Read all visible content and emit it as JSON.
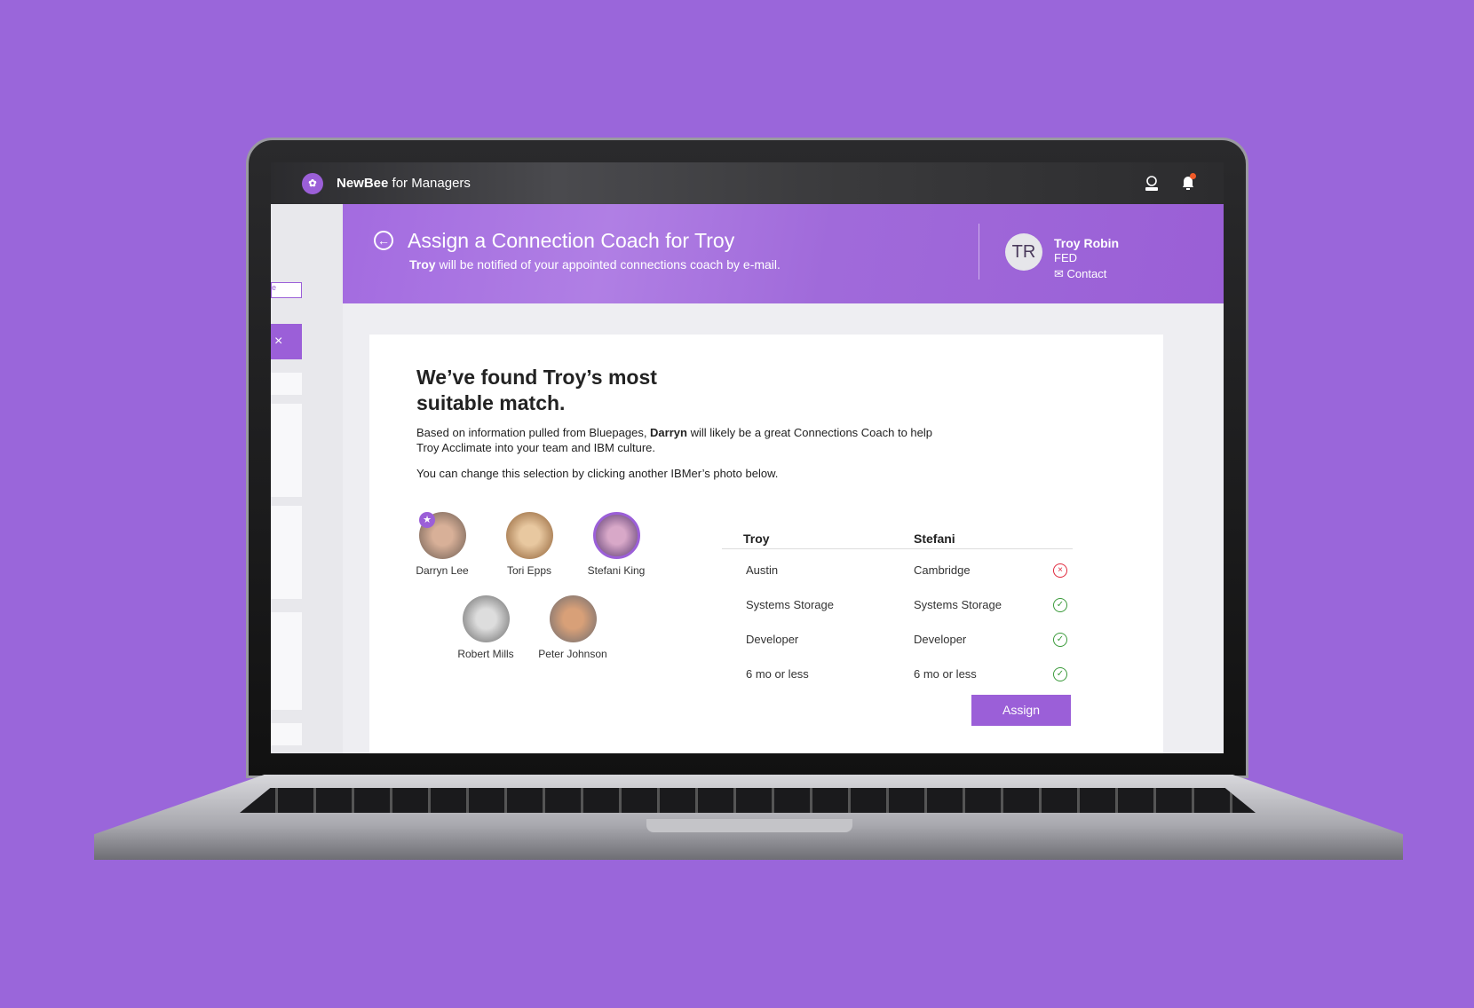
{
  "app": {
    "brand": "NewBee",
    "suffix": " for Managers",
    "logo_icon": "bee-icon",
    "notification_count": "1"
  },
  "sidebar": {
    "input_fragment": "e"
  },
  "header": {
    "title": "Assign a Connection Coach for Troy",
    "subtitle_bold": "Troy",
    "subtitle_rest": " will be notified of your appointed connections coach by e-mail.",
    "employee": {
      "initials": "TR",
      "name": "Troy Robin",
      "role": "FED",
      "contact": "Contact"
    }
  },
  "card": {
    "heading": "We’ve found Troy’s most suitable match.",
    "para1_a": "Based on information pulled from Bluepages, ",
    "para1_b": "Darryn",
    "para1_c": " will likely be a great Connections Coach to help Troy Acclimate into your team and IBM culture.",
    "para2": "You can change this selection by clicking another IBMer’s photo below.",
    "people": [
      {
        "name": "Darryn Lee",
        "recommended": true,
        "color": "#8a7060"
      },
      {
        "name": "Tori Epps",
        "color": "#b08050"
      },
      {
        "name": "Stefani King",
        "selected": true,
        "color": "#7a5a90"
      },
      {
        "name": "Robert Mills",
        "color": "#999999"
      },
      {
        "name": "Peter Johnson",
        "color": "#a0683a"
      }
    ],
    "compare": {
      "headers": [
        "Troy",
        "Stefani"
      ],
      "rows": [
        {
          "troy": "Austin",
          "stefani": "Cambridge",
          "match": false
        },
        {
          "troy": "Systems Storage",
          "stefani": "Systems Storage",
          "match": true
        },
        {
          "troy": "Developer",
          "stefani": "Developer",
          "match": true
        },
        {
          "troy": "6 mo or less",
          "stefani": "6 mo or less",
          "match": true
        }
      ]
    },
    "assign_label": "Assign"
  },
  "colors": {
    "accent": "#9b5fd8",
    "background": "#9a66da",
    "match": "#3a9a3a",
    "mismatch": "#e0283c"
  }
}
